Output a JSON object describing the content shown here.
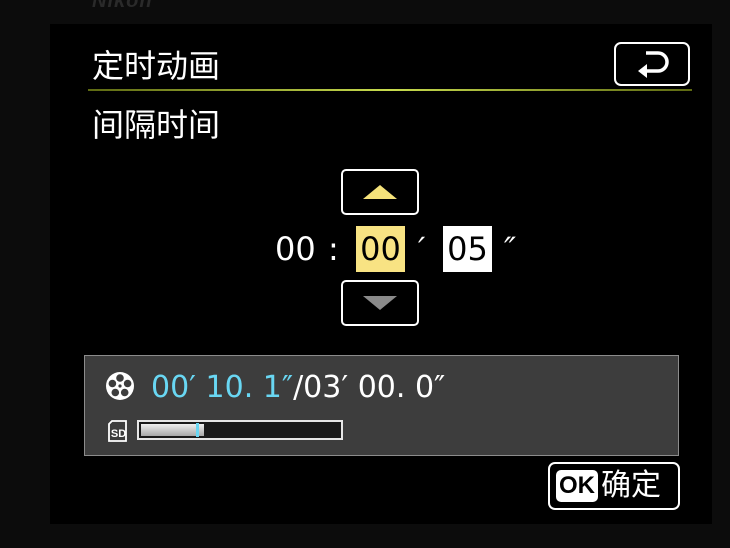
{
  "brand": "Nikon",
  "menu": {
    "title": "定时动画"
  },
  "setting": {
    "title": "间隔时间"
  },
  "interval": {
    "hours": "00",
    "separator": ":",
    "minutes": "00",
    "minute_mark": "′",
    "seconds": "05",
    "second_mark": "″",
    "selected_field": "minutes"
  },
  "recording": {
    "elapsed": "00′ 10. 1″",
    "total": "/03′ 00. 0″",
    "progress_fraction": 0.32,
    "marker_fraction": 0.28
  },
  "footer": {
    "ok_badge": "OK",
    "ok_label": "确定"
  },
  "icons": {
    "back": "back-arrow-icon",
    "up": "up-triangle-icon",
    "down": "down-triangle-icon",
    "reel": "film-reel-icon",
    "sd": "sd-card-icon"
  },
  "colors": {
    "selected_field": "#f8e383",
    "title_rule": "#c8dc4e",
    "elapsed_time": "#69d7f3",
    "panel": "#3d3d3d"
  }
}
